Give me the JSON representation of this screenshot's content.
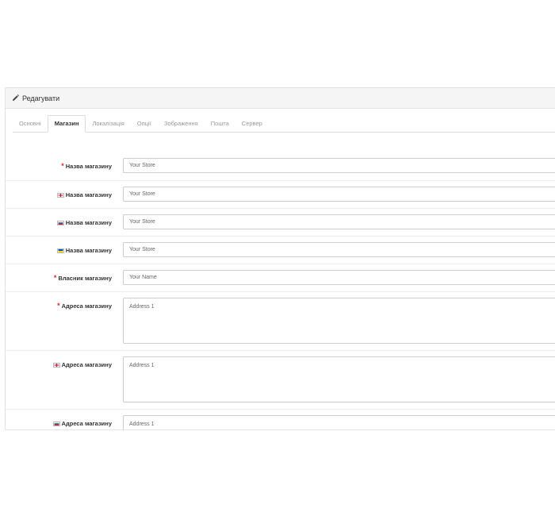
{
  "panel": {
    "title": "Редагувати",
    "icon": "pencil-icon"
  },
  "tabs": [
    {
      "label": "Основні",
      "active": false
    },
    {
      "label": "Магазин",
      "active": true
    },
    {
      "label": "Локалізація",
      "active": false
    },
    {
      "label": "Опції",
      "active": false
    },
    {
      "label": "Зображення",
      "active": false
    },
    {
      "label": "Пошта",
      "active": false
    },
    {
      "label": "Сервер",
      "active": false
    }
  ],
  "fields": [
    {
      "label": "Назва магазину",
      "required": true,
      "flag": null,
      "type": "input",
      "value": "Your Store"
    },
    {
      "label": "Назва магазину",
      "required": false,
      "flag": "en",
      "type": "input",
      "value": "Your Store"
    },
    {
      "label": "Назва магазину",
      "required": false,
      "flag": "ru",
      "type": "input",
      "value": "Your Store"
    },
    {
      "label": "Назва магазину",
      "required": false,
      "flag": "ua",
      "type": "input",
      "value": "Your Store"
    },
    {
      "label": "Власник магазину",
      "required": true,
      "flag": null,
      "type": "input",
      "value": "Your Name"
    },
    {
      "label": "Адреса магазину",
      "required": true,
      "flag": null,
      "type": "textarea",
      "value": "Address 1"
    },
    {
      "label": "Адреса магазину",
      "required": false,
      "flag": "en",
      "type": "textarea",
      "value": "Address 1"
    },
    {
      "label": "Адреса магазину",
      "required": false,
      "flag": "ru",
      "type": "textarea",
      "value": "Address 1"
    }
  ],
  "colors": {
    "required": "#e3252c",
    "border": "#cccccc",
    "heading_bg": "#f5f5f5"
  }
}
